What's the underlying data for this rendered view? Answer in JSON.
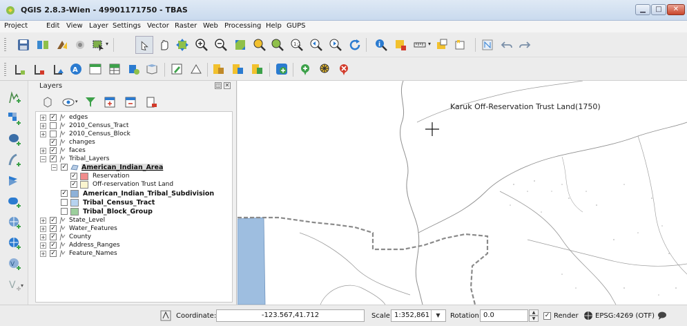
{
  "window": {
    "title": "QGIS 2.8.3-Wien - 49901171750 - TBAS"
  },
  "menu": [
    "Project",
    "Edit",
    "View",
    "Layer",
    "Settings",
    "Vector",
    "Raster",
    "Web",
    "Processing",
    "Help",
    "GUPS"
  ],
  "layers_panel": {
    "title": "Layers",
    "tree": [
      {
        "label": "edges",
        "checked": true,
        "bold": false
      },
      {
        "label": "2010_Census_Tract",
        "checked": false,
        "bold": false
      },
      {
        "label": "2010_Census_Block",
        "checked": false,
        "bold": false
      },
      {
        "label": "changes",
        "checked": true,
        "bold": false
      },
      {
        "label": "faces",
        "checked": true,
        "bold": false
      },
      {
        "label": "Tribal_Layers",
        "checked": true,
        "bold": false
      },
      {
        "label": "American_Indian_Area",
        "checked": true,
        "bold": true
      },
      {
        "label": "Reservation",
        "checked": true,
        "bold": false,
        "color": "#f08c8c"
      },
      {
        "label": "Off-reservation Trust Land",
        "checked": true,
        "bold": false,
        "color": "#fbf5cf"
      },
      {
        "label": "American_Indian_Tribal_Subdivision",
        "checked": true,
        "bold": true,
        "color": "#8eb1d8"
      },
      {
        "label": "Tribal_Census_Tract",
        "checked": false,
        "bold": true,
        "color": "#b7d3ef"
      },
      {
        "label": "Tribal_Block_Group",
        "checked": false,
        "bold": true,
        "color": "#9ccf9c"
      },
      {
        "label": "State_Level",
        "checked": true,
        "bold": false
      },
      {
        "label": "Water_Features",
        "checked": true,
        "bold": false
      },
      {
        "label": "County",
        "checked": true,
        "bold": false
      },
      {
        "label": "Address_Ranges",
        "checked": true,
        "bold": false
      },
      {
        "label": "Feature_Names",
        "checked": true,
        "bold": false
      }
    ]
  },
  "map": {
    "feature_label": "Karuk Off-Reservation Trust Land(1750)",
    "boundary_color": "#8a8a8a",
    "water_color": "#9ebee0"
  },
  "statusbar": {
    "coordinate_label": "Coordinate:",
    "coordinate_value": "-123.567,41.712",
    "scale_label": "Scale",
    "scale_value": "1:352,861",
    "rotation_label": "Rotation:",
    "rotation_value": "0.0",
    "render_label": "Render",
    "crs_label": "EPSG:4269 (OTF)"
  },
  "colors": {
    "accent": "#2b7bd0",
    "green": "#3da14a",
    "red": "#d23a2a",
    "yellow": "#f2c12e"
  }
}
